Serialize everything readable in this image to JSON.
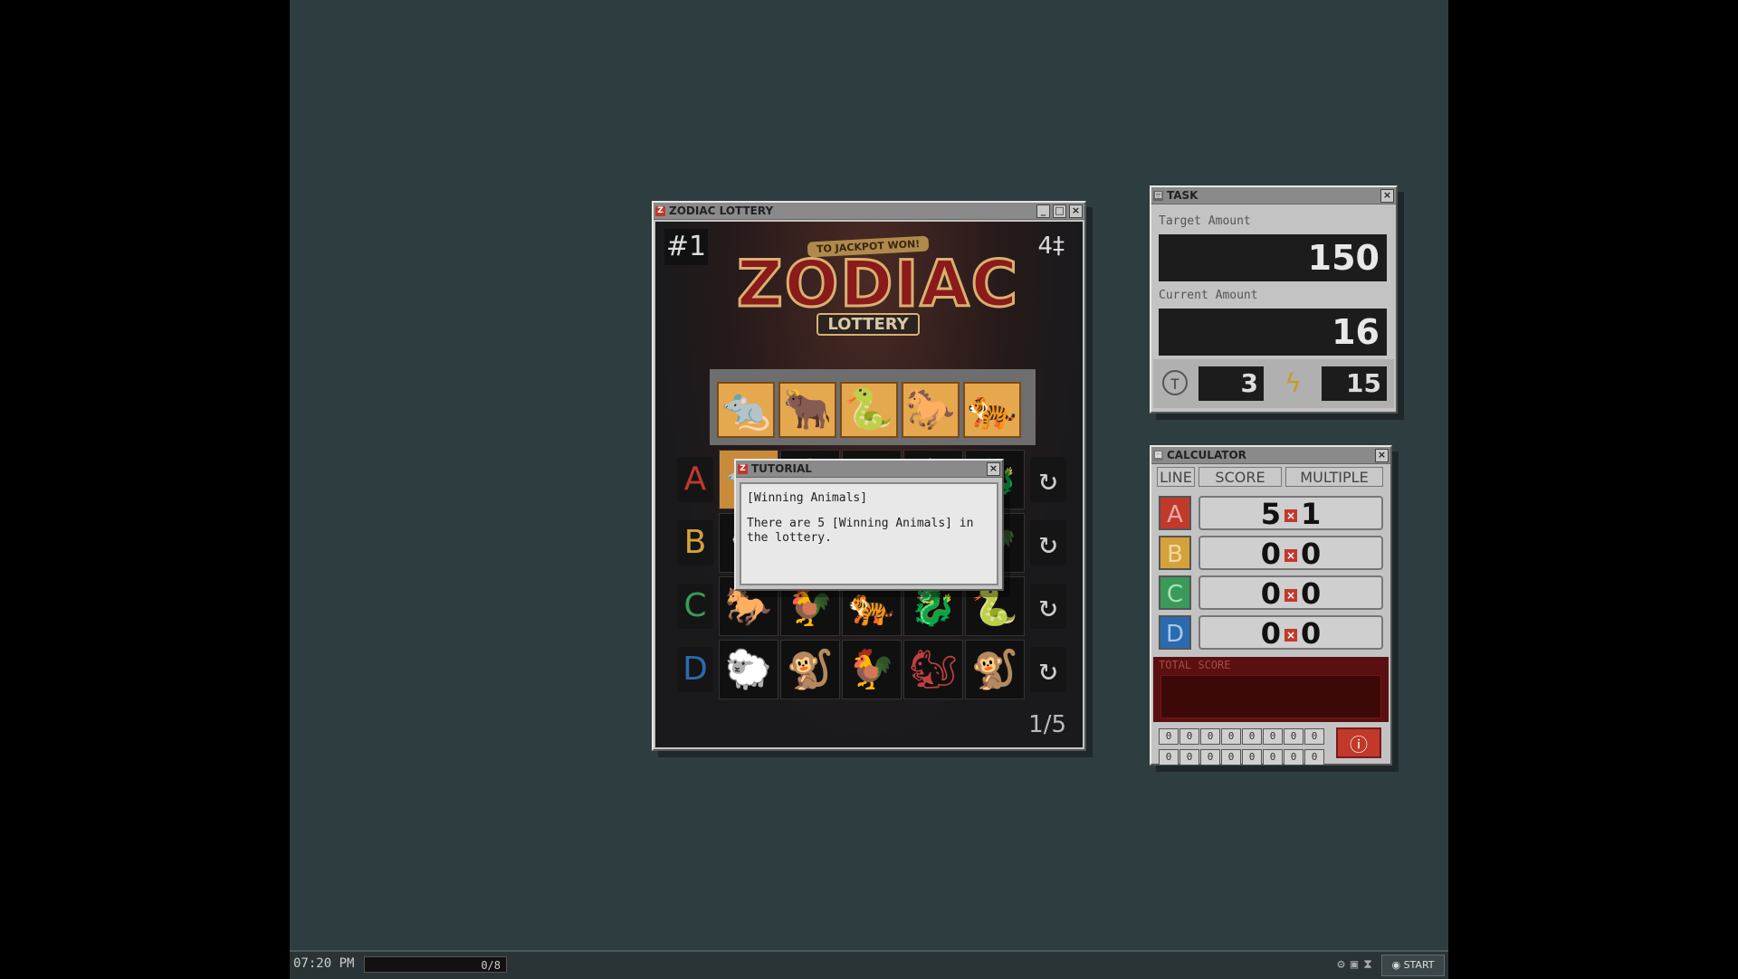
{
  "lottery": {
    "title": "ZODIAC LOTTERY",
    "draw_number": "#1",
    "tickets": "4",
    "logo_banner": "TO JACKPOT WON!",
    "logo_big": "ZODIAC",
    "logo_sub": "LOTTERY",
    "page": "1/5",
    "winning_animals": [
      "rat-icon",
      "ox-icon",
      "snake-icon",
      "horse-icon",
      "tiger-icon"
    ],
    "rows": [
      {
        "label": "A",
        "color": "#c0392b"
      },
      {
        "label": "B",
        "color": "#d4a23a"
      },
      {
        "label": "C",
        "color": "#3a9a5a"
      },
      {
        "label": "D",
        "color": "#2a6ab0"
      }
    ],
    "row_d_animals": [
      "sheep-icon",
      "monkey-icon",
      "rooster-icon",
      "squirrel-icon",
      "monkey-icon"
    ]
  },
  "tutorial": {
    "title": "TUTORIAL",
    "heading": "[Winning Animals]",
    "text": "There are 5 [Winning Animals] in the lottery."
  },
  "task": {
    "title": "TASK",
    "target_label": "Target Amount",
    "target_value": "150",
    "current_label": "Current Amount",
    "current_value": "16",
    "tokens": "3",
    "energy": "15"
  },
  "calculator": {
    "title": "CALCULATOR",
    "headers": [
      "LINE",
      "SCORE",
      "MULTIPLE"
    ],
    "lines": [
      {
        "label": "A",
        "score": "5",
        "multiple": "1",
        "color": "#c0392b"
      },
      {
        "label": "B",
        "score": "0",
        "multiple": "0",
        "color": "#d4a23a"
      },
      {
        "label": "C",
        "score": "0",
        "multiple": "0",
        "color": "#3a9a5a"
      },
      {
        "label": "D",
        "score": "0",
        "multiple": "0",
        "color": "#2a6ab0"
      }
    ],
    "total_label": "TOTAL SCORE",
    "digits": [
      "0",
      "0",
      "0",
      "0",
      "0",
      "0",
      "0",
      "0",
      "0",
      "0",
      "0",
      "0",
      "0",
      "0",
      "0",
      "0"
    ]
  },
  "taskbar": {
    "clock": "07:20 PM",
    "progress": "0/8",
    "start": "START"
  }
}
